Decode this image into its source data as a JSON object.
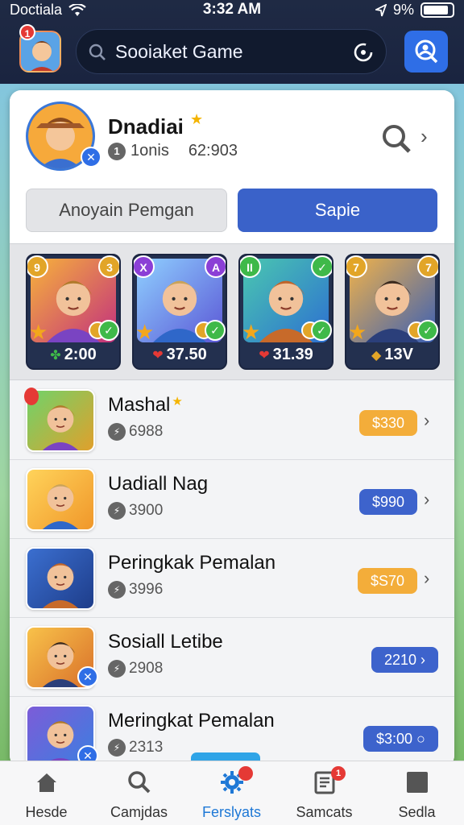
{
  "status_bar": {
    "carrier": "Doctiala",
    "time": "3:32 AM",
    "battery": "9%"
  },
  "header": {
    "app_badge_count": "1",
    "search_text": "Sooiaket Game"
  },
  "profile": {
    "name": "Dnadiai",
    "stat_a": "1onis",
    "stat_b": "62:903",
    "secondary_button": "Anoyain Pemgan",
    "primary_button": "Sapie"
  },
  "cards": [
    {
      "tl": "9",
      "tr": "3",
      "stat": "2:00",
      "icon": "leaf-icon",
      "tl_color": "#e2a528",
      "tr_color": "#e2a528"
    },
    {
      "tl": "X",
      "tr": "A",
      "stat": "37.50",
      "icon": "heart-icon",
      "tl_color": "#8b3fd6",
      "tr_color": "#8b3fd6"
    },
    {
      "tl": "II",
      "tr": "✓",
      "stat": "31.39",
      "icon": "heart-icon",
      "tl_color": "#3fb949",
      "tr_color": "#3fb949"
    },
    {
      "tl": "7",
      "tr": "7",
      "stat": "13V",
      "icon": "diamond-icon",
      "tl_color": "#e2a528",
      "tr_color": "#e2a528"
    }
  ],
  "list": [
    {
      "title": "Mashal",
      "sub": "6988",
      "price": "$330",
      "pill": "orange",
      "star": true,
      "chevron": true
    },
    {
      "title": "Uadiall Nag",
      "sub": "3900",
      "price": "$990",
      "pill": "blue",
      "star": false,
      "chevron": true
    },
    {
      "title": "Peringkak Pemalan",
      "sub": "3996",
      "price": "$S70",
      "pill": "orange",
      "star": false,
      "chevron": true
    },
    {
      "title": "Sosiall Letibe",
      "sub": "2908",
      "price": "2210 ›",
      "pill": "blue",
      "star": false,
      "chevron": false
    },
    {
      "title": "Meringkat Pemalan",
      "sub": "2313",
      "price": "$3:00 ○",
      "pill": "blue",
      "star": false,
      "chevron": false
    }
  ],
  "tabs": [
    {
      "label": "Hesde",
      "icon": "home-icon",
      "active": false
    },
    {
      "label": "Camjdas",
      "icon": "search-icon",
      "active": false
    },
    {
      "label": "Ferslyats",
      "icon": "gear-icon",
      "active": true,
      "badge": ""
    },
    {
      "label": "Samcats",
      "icon": "document-icon",
      "active": false,
      "badge": "1"
    },
    {
      "label": "Sedla",
      "icon": "square-icon",
      "active": false
    }
  ],
  "colors": {
    "header_bg": "#1f2a44",
    "accent_blue": "#3a62c9",
    "price_orange": "#f3ad3a",
    "badge_red": "#e53935"
  }
}
